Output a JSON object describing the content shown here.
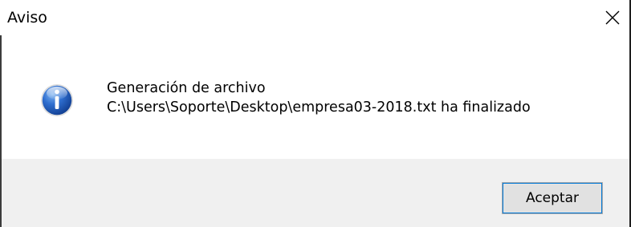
{
  "window": {
    "title": "Aviso",
    "close_icon": "close-icon"
  },
  "message": {
    "icon": "info-icon",
    "line1": "Generación de archivo",
    "line2": "C:\\Users\\Soporte\\Desktop\\empresa03-2018.txt ha finalizado"
  },
  "buttons": {
    "ok_label": "Aceptar"
  },
  "colors": {
    "footer_bg": "#f0f0f0",
    "icon_blue": "#1e5bb8",
    "button_focus": "#0078d7"
  }
}
